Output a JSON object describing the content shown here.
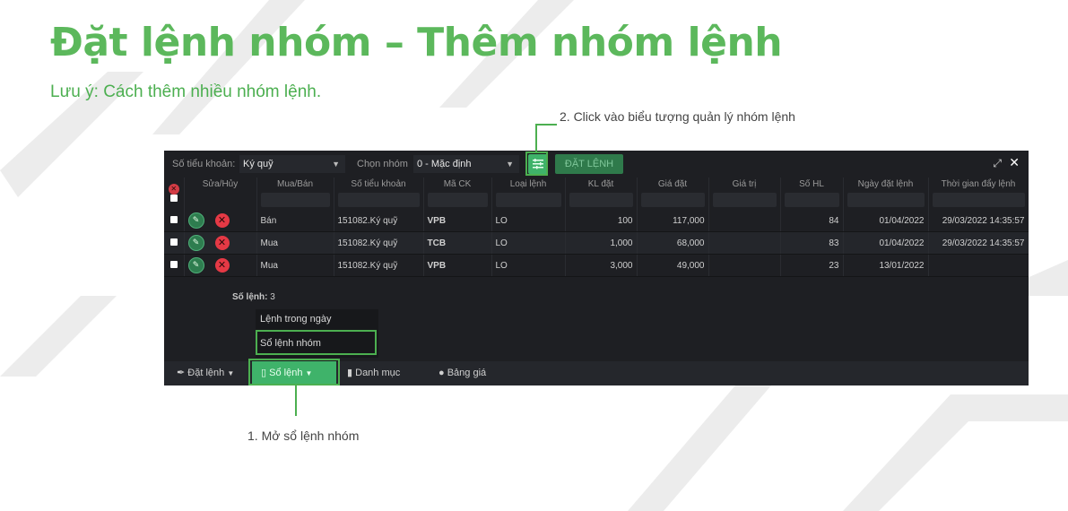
{
  "slide": {
    "title": "Đặt lệnh nhóm – Thêm nhóm lệnh",
    "subtitle": "Lưu ý: Cách thêm nhiều nhóm lệnh.",
    "callout_1": "1. Mở sổ lệnh nhóm",
    "callout_2": "2. Click vào biểu tượng quản lý nhóm lệnh"
  },
  "toolbar": {
    "account_label": "Số tiểu khoản:",
    "account_value": "Ký quỹ",
    "group_label": "Chọn nhóm",
    "group_value": "0 - Mặc định",
    "place_order": "ĐẶT LỆNH"
  },
  "table": {
    "headers": [
      "Sửa/Hủy",
      "Mua/Bán",
      "Số tiểu khoản",
      "Mã CK",
      "Loại lệnh",
      "KL đặt",
      "Giá đặt",
      "Giá trị",
      "Số HL",
      "Ngày đặt lệnh",
      "Thời gian đẩy lệnh"
    ],
    "rows": [
      {
        "side": "Bán",
        "account": "151082.Ký quỹ",
        "symbol": "VPB",
        "type": "LO",
        "qty": "100",
        "price": "117,000",
        "value": "",
        "hl": "84",
        "date": "01/04/2022",
        "pushed": "29/03/2022 14:35:57"
      },
      {
        "side": "Mua",
        "account": "151082.Ký quỹ",
        "symbol": "TCB",
        "type": "LO",
        "qty": "1,000",
        "price": "68,000",
        "value": "",
        "hl": "83",
        "date": "01/04/2022",
        "pushed": "29/03/2022 14:35:57"
      },
      {
        "side": "Mua",
        "account": "151082.Ký quỹ",
        "symbol": "VPB",
        "type": "LO",
        "qty": "3,000",
        "price": "49,000",
        "value": "",
        "hl": "23",
        "date": "13/01/2022",
        "pushed": ""
      }
    ],
    "count_label": "Số lệnh:",
    "count_value": "3"
  },
  "menu": {
    "items": [
      "Lệnh trong ngày",
      "Sổ lệnh nhóm"
    ]
  },
  "bottom_tabs": [
    "Đặt lệnh",
    "Sổ lệnh",
    "Danh mục",
    "Bảng giá"
  ],
  "colors": {
    "accent": "#4caf50",
    "buy": "#3cc07a",
    "sell": "#e0444a",
    "panel": "#1e1f23"
  }
}
